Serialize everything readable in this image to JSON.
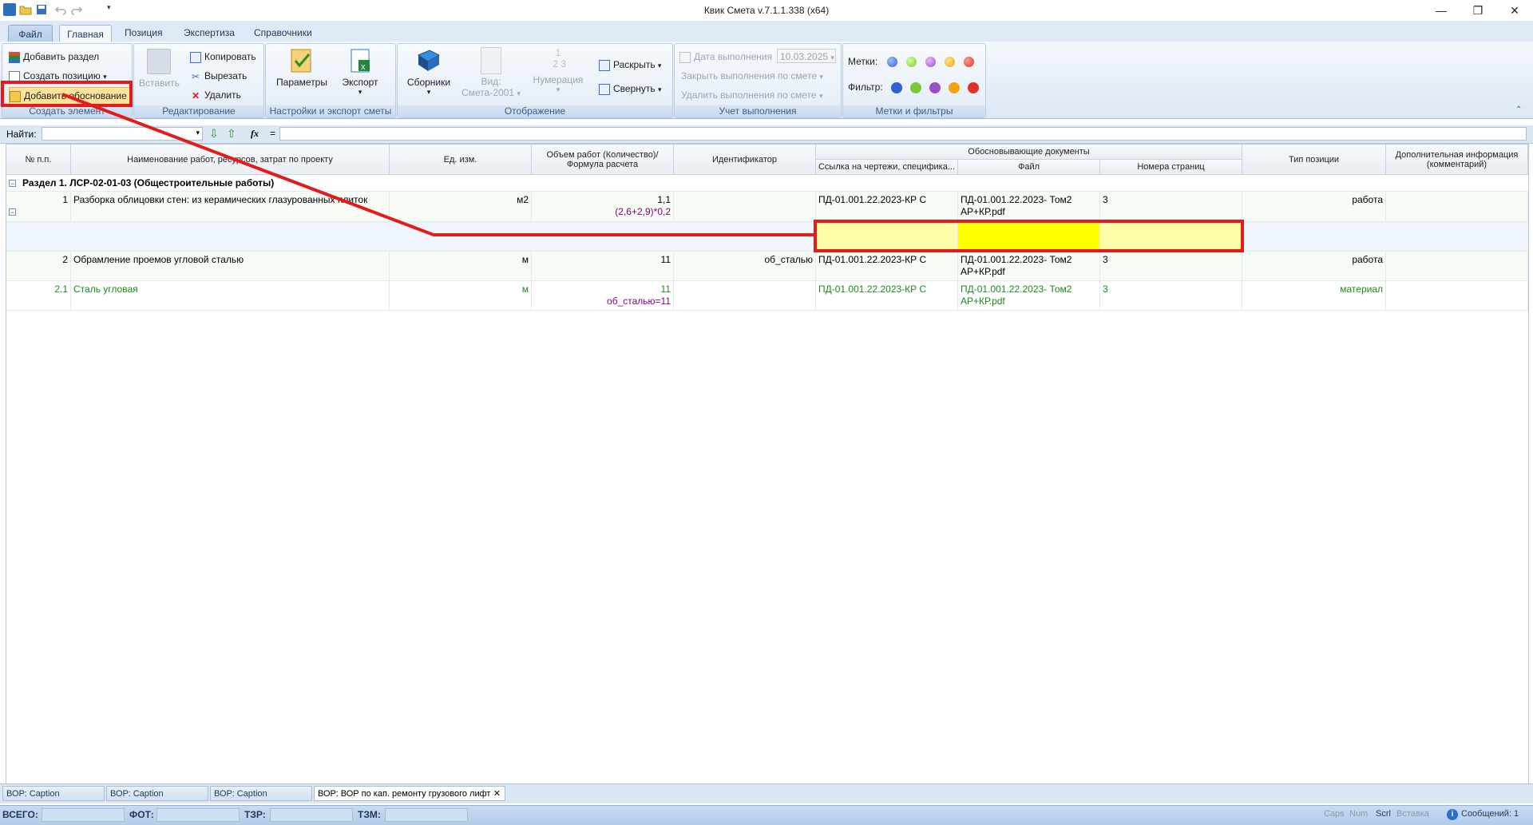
{
  "window": {
    "title": "Квик Смета v.7.1.1.338 (x64)"
  },
  "ribbon_tabs": [
    "Файл",
    "Главная",
    "Позиция",
    "Экспертиза",
    "Справочники"
  ],
  "ribbon": {
    "create": {
      "add_section": "Добавить раздел",
      "create_position": "Создать позицию",
      "add_justification": "Добавить обоснование",
      "caption": "Создать элемент"
    },
    "edit": {
      "paste": "Вставить",
      "copy": "Копировать",
      "cut": "Вырезать",
      "delete": "Удалить",
      "caption": "Редактирование"
    },
    "settings": {
      "params": "Параметры",
      "export": "Экспорт",
      "caption": "Настройки и экспорт сметы"
    },
    "display": {
      "collections": "Сборники",
      "view": "Вид:",
      "view_value": "Смета-2001",
      "numbering": "Нумерация",
      "expand": "Раскрыть",
      "collapse": "Свернуть",
      "caption": "Отображение"
    },
    "accounting": {
      "date_label": "Дата выполнения",
      "date_value": "10.03.2025",
      "close_exec": "Закрыть выполнения по смете",
      "delete_exec": "Удалить выполнения по смете",
      "caption": "Учет выполнения"
    },
    "marks": {
      "marks_label": "Метки:",
      "filter_label": "Фильтр:",
      "caption": "Метки и фильтры",
      "colors": [
        "#2f5fd0",
        "#7cc63a",
        "#9a4fc4",
        "#f0a515",
        "#e0302a"
      ]
    }
  },
  "findbar": {
    "label": "Найти:",
    "fx": "fx",
    "eq": "="
  },
  "grid": {
    "headers": {
      "num": "№ п.п.",
      "name": "Наименование работ, ресурсов, затрат по проекту",
      "unit": "Ед. изм.",
      "volume": "Объем работ (Количество)/ Формула расчета",
      "ident": "Идентификатор",
      "docs": "Обосновывающие  документы",
      "docs_link": "Ссылка на чертежи, специфика...",
      "docs_file": "Файл",
      "docs_pages": "Номера страниц",
      "type": "Тип позиции",
      "extra": "Дополнительная информация (комментарий)"
    },
    "section": "Раздел 1. ЛСР-02-01-03 (Общестроительные работы)",
    "rows": [
      {
        "num": "1",
        "name": "Разборка облицовки стен: из керамических глазурованных плиток",
        "unit": "м2",
        "qty": "1,1",
        "formula": "(2,6+2,9)*0,2",
        "ident": "",
        "link": "ПД-01.001.22.2023-КР С",
        "file": "ПД-01.001.22.2023- Том2 АР+КР.pdf",
        "pages": "3",
        "type": "работа"
      },
      {
        "num": "2",
        "name": "Обрамление проемов угловой сталью",
        "unit": "м",
        "qty": "11",
        "formula": "",
        "ident": "об_сталью",
        "link": "ПД-01.001.22.2023-КР С",
        "file": "ПД-01.001.22.2023- Том2 АР+КР.pdf",
        "pages": "3",
        "type": "работа"
      },
      {
        "num": "2.1",
        "name": "Сталь угловая",
        "unit": "м",
        "qty": "11",
        "formula": "об_сталью=11",
        "ident": "",
        "link": "ПД-01.001.22.2023-КР С",
        "file": "ПД-01.001.22.2023- Том2 АР+КР.pdf",
        "pages": "3",
        "type": "материал"
      }
    ]
  },
  "doc_tabs": [
    "ВОР: Caption (Comment)",
    "ВОР: Caption (Comment)",
    "ВОР: Caption (Comment)",
    "ВОР: ВОР по кап. ремонту грузового лифт"
  ],
  "statusbar": {
    "total": "ВСЕГО:",
    "fot": "ФОТ:",
    "tzr": "ТЗР:",
    "tzm": "ТЗМ:",
    "caps": "Caps",
    "num": "Num",
    "scrl": "Scrl",
    "insert": "Вставка",
    "messages": "Сообщений:  1"
  }
}
